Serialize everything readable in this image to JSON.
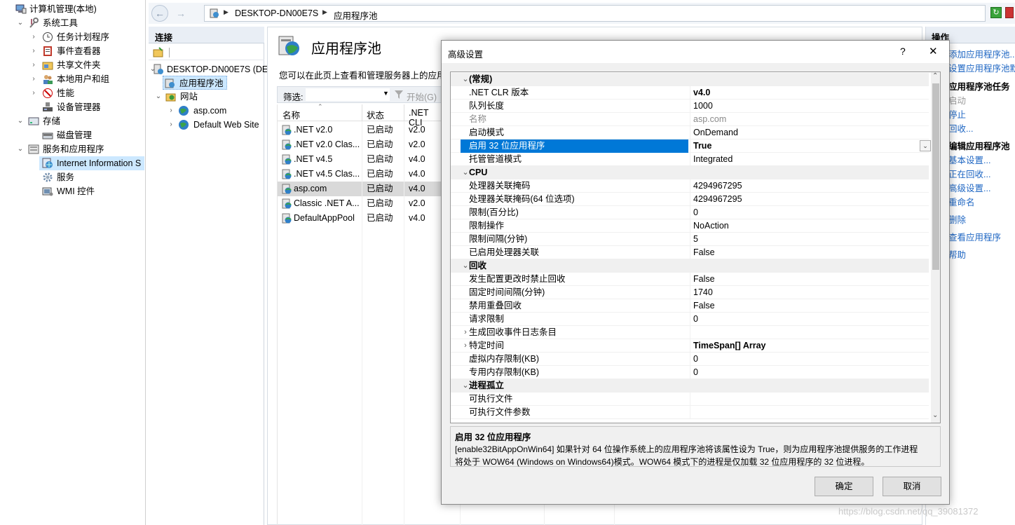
{
  "mmc_tree": {
    "root": "计算机管理(本地)",
    "system_tools": "系统工具",
    "task_scheduler": "任务计划程序",
    "event_viewer": "事件查看器",
    "shared_folders": "共享文件夹",
    "local_users": "本地用户和组",
    "performance": "性能",
    "device_manager": "设备管理器",
    "storage": "存储",
    "disk_management": "磁盘管理",
    "services_apps": "服务和应用程序",
    "iis": "Internet Information S",
    "services": "服务",
    "wmi": "WMI 控件"
  },
  "address_bar": {
    "segments": [
      "DESKTOP-DN00E7S",
      "应用程序池"
    ]
  },
  "connections": {
    "title": "连接",
    "server": "DESKTOP-DN00E7S (DE",
    "app_pools": "应用程序池",
    "sites": "网站",
    "site_items": [
      "asp.com",
      "Default Web Site"
    ]
  },
  "center": {
    "title": "应用程序池",
    "description": "您可以在此页上查看和管理服务器上的应用程",
    "filter_label": "筛选:",
    "start_label": "开始(G)",
    "columns": [
      "名称",
      "状态",
      ".NET CLI"
    ],
    "rows": [
      {
        "name": ".NET v2.0",
        "status": "已启动",
        "clr": "v2.0"
      },
      {
        "name": ".NET v2.0 Clas...",
        "status": "已启动",
        "clr": "v2.0"
      },
      {
        "name": ".NET v4.5",
        "status": "已启动",
        "clr": "v4.0"
      },
      {
        "name": ".NET v4.5 Clas...",
        "status": "已启动",
        "clr": "v4.0"
      },
      {
        "name": "asp.com",
        "status": "已启动",
        "clr": "v4.0"
      },
      {
        "name": "Classic .NET A...",
        "status": "已启动",
        "clr": "v2.0"
      },
      {
        "name": "DefaultAppPool",
        "status": "已启动",
        "clr": "v4.0"
      }
    ]
  },
  "actions": {
    "title": "操作",
    "add_pool": "添加应用程序池...",
    "set_defaults": "设置应用程序池默",
    "tasks_header": "应用程序池任务",
    "start": "启动",
    "stop": "停止",
    "recycle": "回收...",
    "edit_header": "编辑应用程序池",
    "basic": "基本设置...",
    "recycling": "正在回收...",
    "advanced": "高级设置...",
    "rename": "重命名",
    "delete": "删除",
    "view_apps": "查看应用程序",
    "help": "帮助"
  },
  "dialog": {
    "title": "高级设置",
    "help_glyph": "?",
    "close_glyph": "✕",
    "rows": [
      {
        "type": "cat",
        "k": "(常规)"
      },
      {
        "k": ".NET CLR 版本",
        "v": "v4.0",
        "bold": true
      },
      {
        "k": "队列长度",
        "v": "1000"
      },
      {
        "k": "名称",
        "v": "asp.com",
        "gray": true
      },
      {
        "k": "启动模式",
        "v": "OnDemand"
      },
      {
        "k": "启用 32 位应用程序",
        "v": "True",
        "bold": true,
        "selected": true
      },
      {
        "k": "托管管道模式",
        "v": "Integrated"
      },
      {
        "type": "cat",
        "k": "CPU"
      },
      {
        "k": "处理器关联掩码",
        "v": "4294967295"
      },
      {
        "k": "处理器关联掩码(64 位选项)",
        "v": "4294967295"
      },
      {
        "k": "限制(百分比)",
        "v": "0"
      },
      {
        "k": "限制操作",
        "v": "NoAction"
      },
      {
        "k": "限制间隔(分钟)",
        "v": "5"
      },
      {
        "k": "已启用处理器关联",
        "v": "False"
      },
      {
        "type": "cat",
        "k": "回收"
      },
      {
        "k": "发生配置更改时禁止回收",
        "v": "False"
      },
      {
        "k": "固定时间间隔(分钟)",
        "v": "1740"
      },
      {
        "k": "禁用重叠回收",
        "v": "False"
      },
      {
        "k": "请求限制",
        "v": "0"
      },
      {
        "k": "生成回收事件日志条目",
        "v": "",
        "expand": true
      },
      {
        "k": "特定时间",
        "v": "TimeSpan[] Array",
        "bold": true,
        "expand": true
      },
      {
        "k": "虚拟内存限制(KB)",
        "v": "0"
      },
      {
        "k": "专用内存限制(KB)",
        "v": "0"
      },
      {
        "type": "cat",
        "k": "进程孤立"
      },
      {
        "k": "可执行文件",
        "v": ""
      },
      {
        "k": "可执行文件参数",
        "v": ""
      }
    ],
    "desc_title": "启用 32 位应用程序",
    "desc_line1": "[enable32BitAppOnWin64] 如果针对 64 位操作系统上的应用程序池将该属性设为 True，则为应用程序池提供服务的工作进程",
    "desc_line2": "将处于 WOW64 (Windows on Windows64)模式。WOW64 模式下的进程是仅加载 32 位应用程序的 32 位进程。",
    "ok": "确定",
    "cancel": "取消"
  },
  "watermark": "https://blog.csdn.net/qq_39081372"
}
